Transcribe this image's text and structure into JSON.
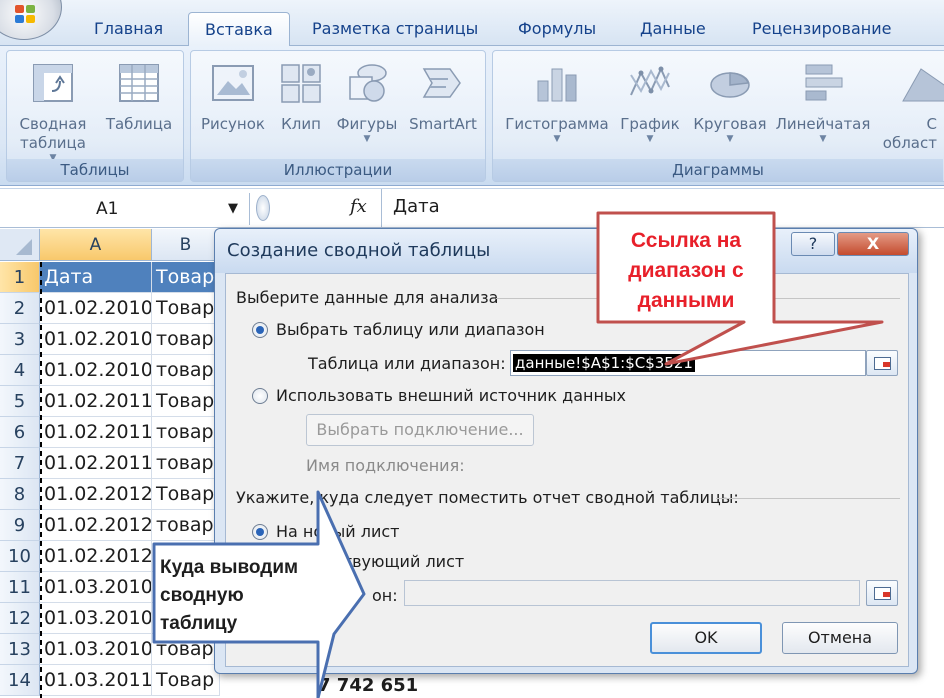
{
  "ribbon": {
    "tabs": [
      "Главная",
      "Вставка",
      "Разметка страницы",
      "Формулы",
      "Данные",
      "Рецензирование"
    ],
    "active_tab": "Вставка",
    "groups": {
      "tables": {
        "label": "Таблицы",
        "pivot": "Сводная\nтаблица",
        "table": "Таблица"
      },
      "illustrations": {
        "label": "Иллюстрации",
        "picture": "Рисунок",
        "clip": "Клип",
        "shapes": "Фигуры",
        "smartart": "SmartArt"
      },
      "charts": {
        "label": "Диаграммы",
        "histogram": "Гистограмма",
        "line": "График",
        "pie": "Круговая",
        "bar": "Линейчатая",
        "area": "С\nобласт"
      }
    }
  },
  "formula_bar": {
    "namebox": "A1",
    "fx": "fx",
    "value": "Дата"
  },
  "grid": {
    "columns": [
      "A",
      "B"
    ],
    "rows": [
      {
        "n": "1",
        "a": "Дата",
        "b": "Товар"
      },
      {
        "n": "2",
        "a": "01.02.2010",
        "b": "Товар"
      },
      {
        "n": "3",
        "a": "01.02.2010",
        "b": "товар"
      },
      {
        "n": "4",
        "a": "01.02.2010",
        "b": "товар"
      },
      {
        "n": "5",
        "a": "01.02.2011",
        "b": "Товар"
      },
      {
        "n": "6",
        "a": "01.02.2011",
        "b": "товар"
      },
      {
        "n": "7",
        "a": "01.02.2011",
        "b": "товар"
      },
      {
        "n": "8",
        "a": "01.02.2012",
        "b": "Товар"
      },
      {
        "n": "9",
        "a": "01.02.2012",
        "b": "товар"
      },
      {
        "n": "10",
        "a": "01.02.2012",
        "b": "товар"
      },
      {
        "n": "11",
        "a": "01.03.2010",
        "b": "Товар"
      },
      {
        "n": "12",
        "a": "01.03.2010",
        "b": "товар"
      },
      {
        "n": "13",
        "a": "01.03.2010",
        "b": "товар"
      },
      {
        "n": "14",
        "a": "01.03.2011",
        "b": "Товар 1"
      }
    ],
    "stray_value": "7 742 651"
  },
  "dialog": {
    "title": "Создание сводной таблицы",
    "help": "?",
    "close": "X",
    "section1": "Выберите данные для анализа",
    "opt_select_table": "Выбрать таблицу или диапазон",
    "range_label": "Таблица или диапазон:",
    "range_value": "данные!$A$1:$C$3521",
    "opt_external": "Использовать внешний источник данных",
    "choose_connection": "Выбрать подключение...",
    "connection_name": "Имя подключения:",
    "section2": "Укажите, куда следует поместить отчет сводной таблицы:",
    "opt_new_sheet": "На новый лист",
    "opt_existing_sheet": "ствующий лист",
    "location_label": "он:",
    "location_value": "",
    "ok": "OK",
    "cancel": "Отмена"
  },
  "callouts": {
    "range_note": "Ссылка на\nдиапазон с\nданными",
    "output_note": "Куда выводим\nсводную\nтаблицу"
  },
  "colors": {
    "header_fill": "#4f81bd",
    "callout_red": "#e8202a",
    "callout_blue": "#4a6fb0",
    "ribbon_text": "#15428b"
  }
}
